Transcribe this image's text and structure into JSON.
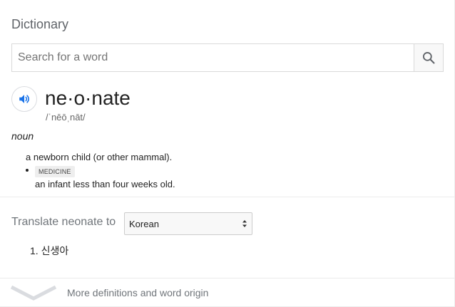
{
  "header": {
    "title": "Dictionary"
  },
  "search": {
    "placeholder": "Search for a word",
    "value": ""
  },
  "entry": {
    "word": "ne·o·nate",
    "phonetic": "/ˈnēōˌnāt/",
    "part_of_speech": "noun",
    "definitions": [
      {
        "text": "a newborn child (or other mammal)."
      },
      {
        "label": "MEDICINE",
        "text": "an infant less than four weeks old."
      }
    ]
  },
  "translate": {
    "label": "Translate neonate to",
    "selected_language": "Korean",
    "results": [
      "1. 신생아"
    ]
  },
  "footer": {
    "more_label": "More definitions and word origin"
  },
  "colors": {
    "accent_blue": "#1a73e8",
    "muted_text": "#70757a",
    "divider": "#ebebeb"
  }
}
